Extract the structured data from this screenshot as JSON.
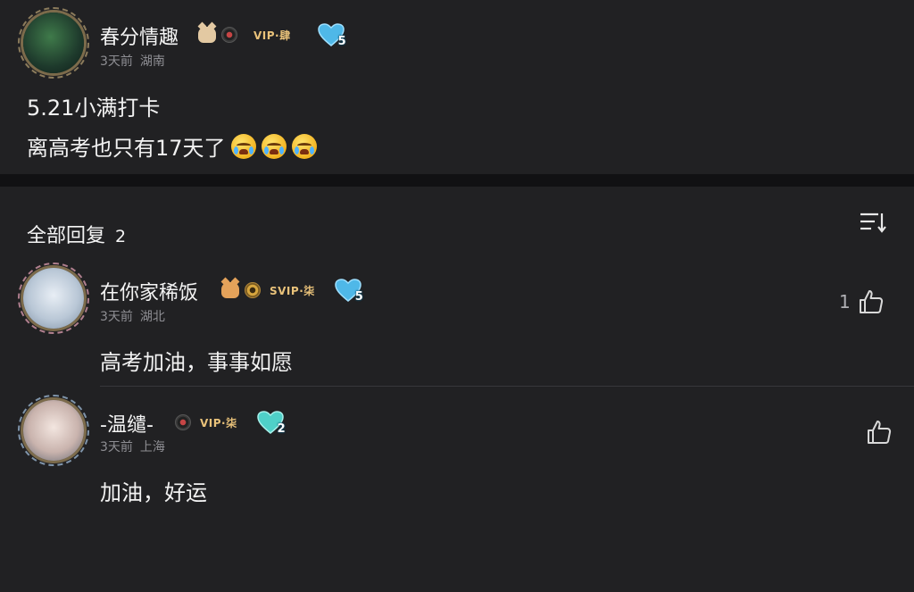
{
  "post": {
    "author": {
      "name": "春分情趣",
      "vip_label": "VIP·肆",
      "fan_level": "5",
      "time": "3天前",
      "location": "湖南"
    },
    "lines": [
      "5.21小满打卡",
      "离高考也只有17天了"
    ],
    "emoji_name": "loudly-crying-emoji",
    "emoji_count": 3
  },
  "replies_header": {
    "title": "全部回复",
    "count": "2"
  },
  "replies": [
    {
      "name": "在你家稀饭",
      "vip_label": "SVIP·柒",
      "fan_level": "5",
      "time": "3天前",
      "location": "湖北",
      "text": "高考加油，事事如愿",
      "likes": "1"
    },
    {
      "name": "-温缱-",
      "vip_label": "VIP·柒",
      "fan_level": "2",
      "time": "3天前",
      "location": "上海",
      "text": "加油，好运",
      "likes": ""
    }
  ],
  "colors": {
    "background": "#212123",
    "divider_band": "#111113",
    "text_primary": "#f2f2f2",
    "text_secondary": "#8e8e93",
    "vip_gold": "#e9c27a",
    "fan_heart": "#4fb8e8"
  },
  "icons": [
    "sort-icon",
    "thumbs-up-icon",
    "heart-level-icon",
    "medal-icon",
    "pet-icon"
  ]
}
